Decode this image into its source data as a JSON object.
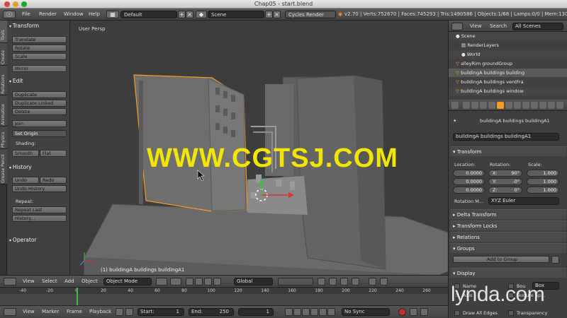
{
  "window": {
    "title": "Chap05 - start.blend"
  },
  "topbar": {
    "menus": [
      "File",
      "Render",
      "Window",
      "Help"
    ],
    "screen_layout": "Default",
    "scene": "Scene",
    "render_engine": "Cycles Render",
    "stats": "v2.70 | Verts:752670 | Faces:745293 | Tris:1490586 | Objects:1/68 | Lamps:0/0 | Mem:130.2"
  },
  "left_tabs": [
    "Tools",
    "Create",
    "Relations",
    "Animation",
    "Physics",
    "Grease Pencil"
  ],
  "toolshelf": {
    "transform_header": "Transform",
    "transform_buttons": [
      "Translate",
      "Rotate",
      "Scale",
      "Mirror"
    ],
    "edit_header": "Edit",
    "edit_buttons": [
      "Duplicate",
      "Duplicate Linked",
      "Delete",
      "Join"
    ],
    "set_origin": "Set Origin",
    "shading_label": "Shading:",
    "smooth": "Smooth",
    "flat": "Flat",
    "history_header": "History",
    "undo": "Undo",
    "redo": "Redo",
    "undo_history": "Undo History",
    "repeat_label": "Repeat:",
    "repeat_last": "Repeat Last",
    "history_btn": "History...",
    "operator_header": "Operator"
  },
  "viewport": {
    "view_label": "User Persp",
    "object_label": "(1) buildingA buildings buildingA1",
    "watermark": "WWW.CGTSJ.COM"
  },
  "view3d_header": {
    "menus": [
      "View",
      "Select",
      "Add",
      "Object"
    ],
    "mode": "Object Mode",
    "orientation": "Global"
  },
  "timeline": {
    "ticks": [
      "-40",
      "-20",
      "0",
      "20",
      "40",
      "60",
      "80",
      "100",
      "120",
      "140",
      "160",
      "180",
      "200",
      "220",
      "240",
      "260"
    ],
    "menus": [
      "View",
      "Marker",
      "Frame",
      "Playback"
    ],
    "start_label": "Start:",
    "start_value": "1",
    "end_label": "End:",
    "end_value": "250",
    "current_frame": "1",
    "sync": "No Sync"
  },
  "outliner": {
    "view_menu": "View",
    "search_menu": "Search",
    "display": "All Scenes",
    "rows": [
      "Scene",
      "RenderLayers",
      "World",
      "alleyRim groundGroup",
      "buildingA buildings building",
      "buildingA buildings ventFra",
      "buildingA buildings window"
    ]
  },
  "properties": {
    "breadcrumb": "buildingA buildings buildingA1",
    "object_name": "buildingA buildings buildingA1",
    "transform_header": "Transform",
    "location_label": "Location:",
    "rotation_label": "Rotation:",
    "scale_label": "Scale:",
    "location": [
      "0.0000",
      "0.0000",
      "0.0000"
    ],
    "rotation_axes": [
      "X:",
      "Y:",
      "Z:"
    ],
    "rotation": [
      "90°",
      "-0°",
      "0°"
    ],
    "scale": [
      "1.000",
      "1.000",
      "1.000"
    ],
    "rotation_mode_label": "Rotation M...",
    "rotation_mode": "XYZ Euler",
    "delta_transform": "Delta Transform",
    "transform_locks": "Transform Locks",
    "relations": "Relations",
    "groups": "Groups",
    "add_to_group": "Add to Group",
    "display": "Display",
    "display_name": "Name",
    "display_axis": "Axis",
    "display_draw_all_edges": "Draw All Edges",
    "display_bounds": "Bou",
    "display_box": "Box",
    "display_texture_space": "Texture Sp...",
    "display_transparency": "Transparency"
  },
  "branding": {
    "lynda": "lynda.com"
  },
  "colors": {
    "accent_orange": "#f39a27",
    "watermark_yellow": "#f2e600",
    "panel_bg": "#414141"
  }
}
